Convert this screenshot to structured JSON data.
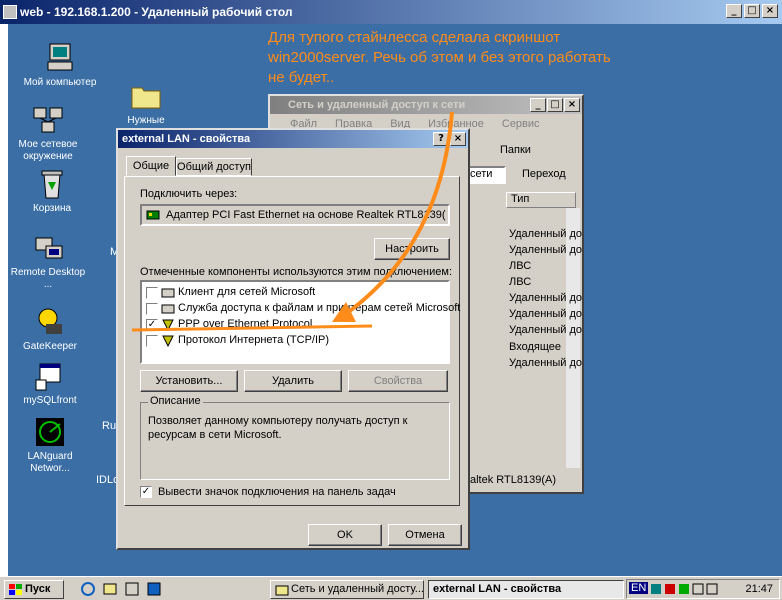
{
  "rdp_title": "web - 192.168.1.200 - Удаленный рабочий стол",
  "desktop_icons": [
    {
      "label": "Мой компьютер"
    },
    {
      "label": "Мое сетевое окружение"
    },
    {
      "label": "Корзина"
    },
    {
      "label": "Remote Desktop ..."
    },
    {
      "label": "GateKeeper"
    },
    {
      "label": "mySQLfront"
    },
    {
      "label": "LANguard Networ..."
    },
    {
      "label": "Нужные"
    }
  ],
  "partial_labels": {
    "m": "M",
    "ru": "Ru",
    "idl": "IDLo"
  },
  "annotation": "Для тупого стайнлесса сделала скриншот win2000server. Речь об этом и без этого работать не будет..",
  "network_window": {
    "title": "Сеть и удаленный доступ к сети",
    "menu": [
      "Файл",
      "Правка",
      "Вид",
      "Избранное",
      "Сервис"
    ],
    "folders_label": "Папки",
    "address_fragment": "сети",
    "go_label": "Переход",
    "column_type": "Тип",
    "types": [
      "Удаленный до",
      "Удаленный до",
      "ЛВС",
      "ЛВС",
      "Удаленный до",
      "Удаленный до",
      "Удаленный до",
      "Входящее",
      "Удаленный до"
    ],
    "status_text": "altek RTL8139(A)"
  },
  "properties_dialog": {
    "title": "external LAN - свойства",
    "tabs": [
      "Общие",
      "Общий доступ"
    ],
    "connect_via_label": "Подключить через:",
    "adapter_name": "Адаптер PCI Fast Ethernet на основе Realtek RTL8139(",
    "configure_label": "Настроить",
    "components_label": "Отмеченные компоненты используются этим подключением:",
    "components": [
      {
        "label": "Клиент для сетей Microsoft",
        "checked": false
      },
      {
        "label": "Служба доступа к файлам и принтерам сетей Microsoft",
        "checked": false
      },
      {
        "label": "PPP over Ethernet Protocol",
        "checked": true
      },
      {
        "label": "Протокол Интернета (TCP/IP)",
        "checked": false
      }
    ],
    "install_label": "Установить...",
    "remove_label": "Удалить",
    "properties_label": "Свойства",
    "description_group": "Описание",
    "description_text": "Позволяет данному компьютеру получать доступ к ресурсам в сети Microsoft.",
    "show_icon_label": "Вывести значок подключения на панель задач",
    "show_icon_checked": true,
    "ok_label": "OK",
    "cancel_label": "Отмена"
  },
  "taskbar": {
    "start_label": "Пуск",
    "tasks": [
      {
        "label": "Сеть и удаленный досту...",
        "active": false
      },
      {
        "label": "external LAN - свойства",
        "active": true
      }
    ],
    "tray_lang": "EN",
    "clock": "21:47"
  },
  "colors": {
    "accent_annotation": "#ff8c1a",
    "title_active": "#0a246a",
    "desktop": "#3a6ea5"
  }
}
